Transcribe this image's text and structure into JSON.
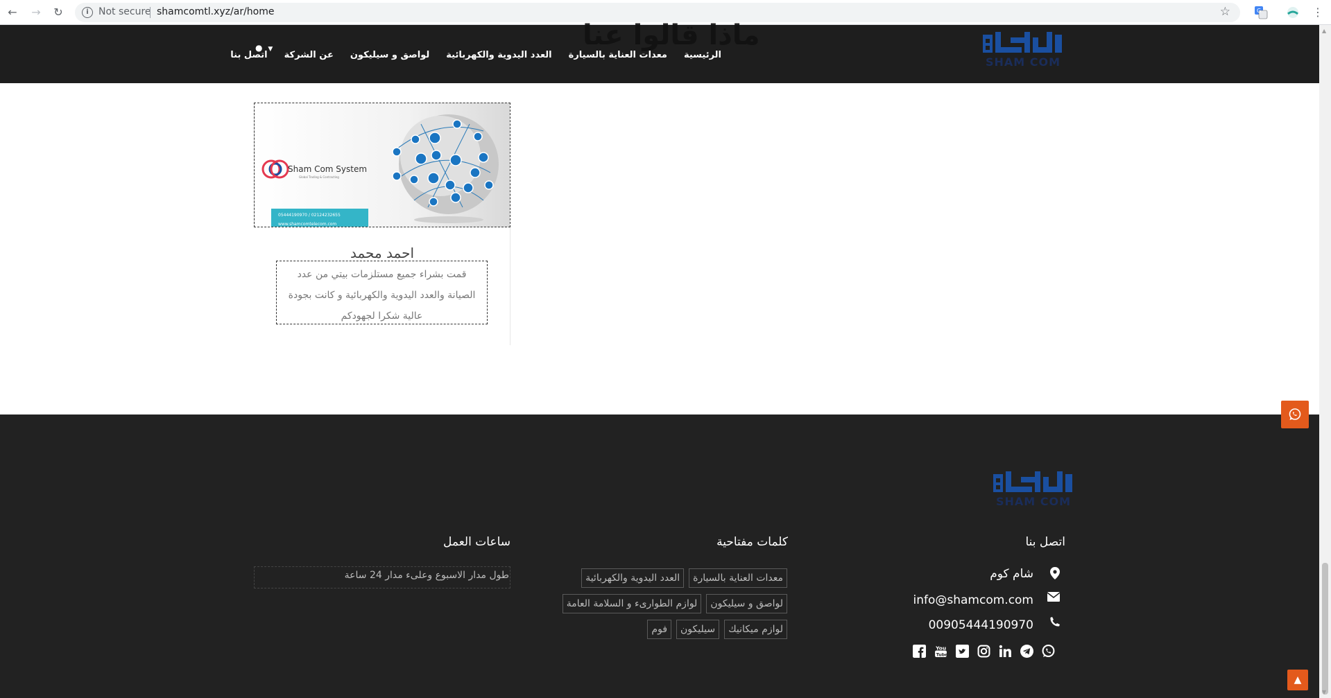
{
  "browser": {
    "security_label": "Not secure",
    "url": "shamcomtl.xyz/ar/home"
  },
  "header": {
    "background_title": "ماذا قالوا عنا",
    "nav_items": [
      "الرئيسية",
      "معدات العناية بالسيارة",
      "العدد اليدوية والكهربائية",
      "لواصق و سيليكون",
      "عن الشركة",
      "اتصل بنا"
    ],
    "logo_text": "SHAM COM"
  },
  "testimonial": {
    "image_brand": "Sham Com System",
    "image_tagline": "Global Trading & Contracting",
    "image_phone": "05444190970 / 02124232655",
    "image_site": "www.shamcomtelecom.com",
    "name": "احمد محمد",
    "quote": "قمت بشراء جميع مستلزمات بيتي من عدد الصيانة والعدد اليدوية والكهربائية و كانت بجودة عالية شكرا لجهودكم"
  },
  "footer": {
    "logo_text": "SHAM COM",
    "contact": {
      "heading": "اتصل بنا",
      "address": "شام كوم",
      "email": "info@shamcom.com",
      "phone": "00905444190970"
    },
    "keywords": {
      "heading": "كلمات مفتاحية",
      "tags": [
        "معدات العناية بالسيارة",
        "العدد اليدوية والكهربائية",
        "لواصق و سيليكون",
        "لوازم الطوارىء و السلامة العامة",
        "لوازم ميكانيك",
        "سيليكون",
        "فوم"
      ]
    },
    "hours": {
      "heading": "ساعات العمل",
      "text": "طول مدار الاسبوع وعلىء مدار 24 ساعة"
    },
    "social_icons": [
      "whatsapp-icon",
      "telegram-icon",
      "linkedin-icon",
      "instagram-icon",
      "twitter-icon",
      "youtube-icon",
      "facebook-icon"
    ]
  },
  "colors": {
    "header_bg": "#1e1e1e",
    "footer_bg": "#222222",
    "accent": "#e35a1c",
    "logo_blue": "#1a4fa0"
  }
}
